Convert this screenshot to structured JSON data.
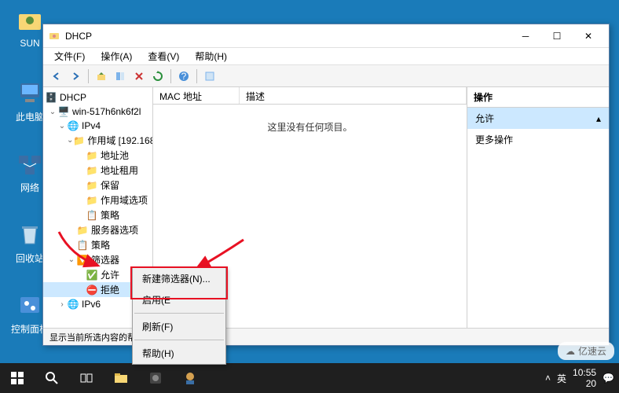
{
  "desktop": {
    "icons": {
      "sun": "SUN",
      "pc": "此电脑",
      "net": "网络",
      "bin": "回收站",
      "ctrl": "控制面板"
    }
  },
  "window": {
    "title": "DHCP",
    "menu": [
      "文件(F)",
      "操作(A)",
      "查看(V)",
      "帮助(H)"
    ]
  },
  "tree": {
    "root": "DHCP",
    "server": "win-517h6nk6f2l",
    "ipv4": "IPv4",
    "scope": "作用域 [192.168.",
    "pool": "地址池",
    "lease": "地址租用",
    "reserve": "保留",
    "options": "作用域选项",
    "policy": "策略",
    "serverOptions": "服务器选项",
    "policy2": "策略",
    "filters": "筛选器",
    "allow": "允许",
    "deny": "拒绝",
    "ipv6": "IPv6"
  },
  "list": {
    "col1": "MAC 地址",
    "col2": "描述",
    "empty": "这里没有任何项目。"
  },
  "actions": {
    "header": "操作",
    "item1": "允许",
    "item2": "更多操作"
  },
  "context": {
    "newFilter": "新建筛选器(N)...",
    "enable": "启用(E",
    "refresh": "刷新(F)",
    "help": "帮助(H)"
  },
  "statusbar": "显示当前所选内容的帮",
  "taskbar": {
    "time": "10:55",
    "date": "20",
    "ime": "英",
    "watermark": "亿速云"
  }
}
